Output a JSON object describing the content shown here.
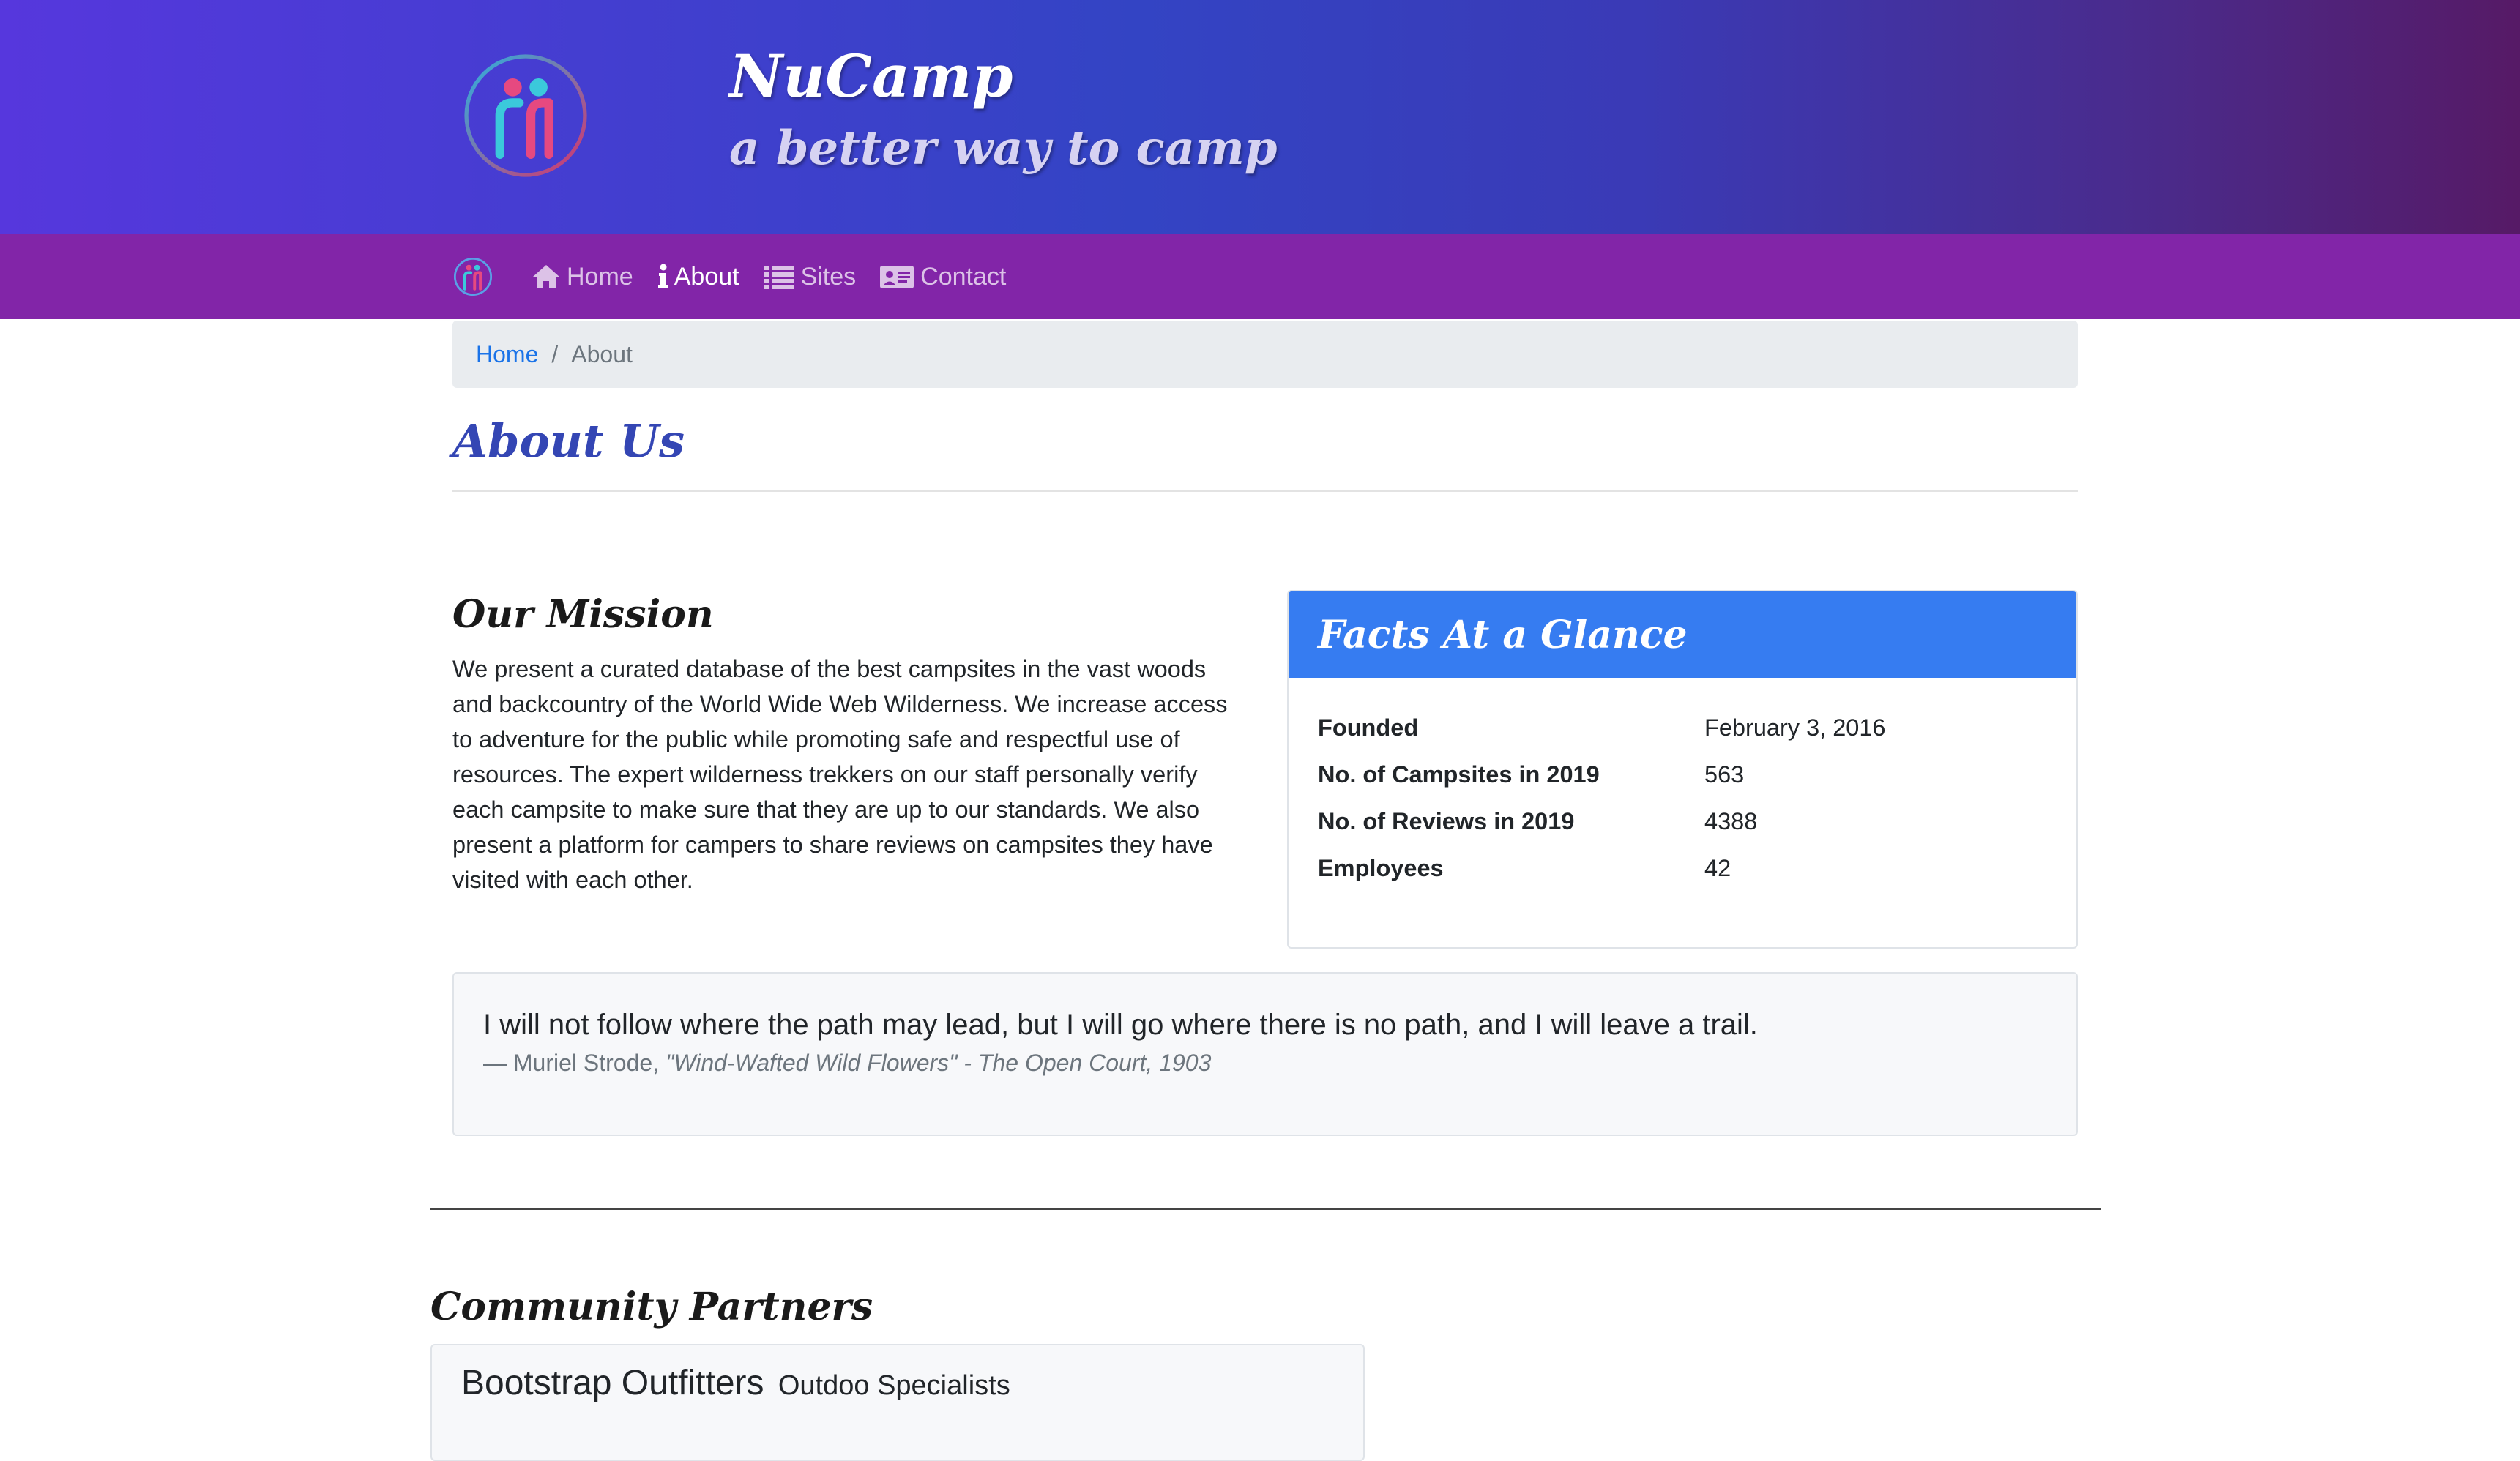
{
  "header": {
    "title": "NuCamp",
    "tagline": "a better way to camp",
    "logo_icon": "nucamp-logo-icon"
  },
  "navbar": {
    "items": [
      {
        "label": "Home",
        "icon": "home-icon"
      },
      {
        "label": "About",
        "icon": "info-icon",
        "active": true
      },
      {
        "label": "Sites",
        "icon": "list-icon"
      },
      {
        "label": "Contact",
        "icon": "address-card-icon"
      }
    ]
  },
  "breadcrumb": {
    "home": "Home",
    "separator": "/",
    "current": "About"
  },
  "page": {
    "title": "About Us"
  },
  "mission": {
    "title": "Our Mission",
    "text": "We present a curated database of the best campsites in the vast woods and backcountry of the World Wide Web Wilderness. We increase access to adventure for the public while promoting safe and respectful use of resources. The expert wilderness trekkers on our staff personally verify each campsite to make sure that they are up to our standards. We also present a platform for campers to share reviews on campsites they have visited with each other."
  },
  "facts": {
    "title": "Facts At a Glance",
    "rows": [
      {
        "label": "Founded",
        "value": "February 3, 2016"
      },
      {
        "label": "No. of Campsites in 2019",
        "value": "563"
      },
      {
        "label": "No. of Reviews in 2019",
        "value": "4388"
      },
      {
        "label": "Employees",
        "value": "42"
      }
    ]
  },
  "quote": {
    "text": "I will not follow where the path may lead, but I will go where there is no path, and I will leave a trail.",
    "dash": "—",
    "author": "Muriel Strode,",
    "source": "\"Wind-Wafted Wild Flowers\" - The Open Court, 1903"
  },
  "partners": {
    "title": "Community Partners",
    "items": [
      {
        "name": "Bootstrap Outfitters",
        "subtitle": "Outdoo Specialists"
      }
    ]
  },
  "colors": {
    "header_gradient_start": "#5637dd",
    "header_gradient_end": "#561a66",
    "navbar": "#8225a8",
    "facts_header": "#367cf1",
    "title_blue": "#3446b4",
    "link_blue": "#1a73e8"
  }
}
